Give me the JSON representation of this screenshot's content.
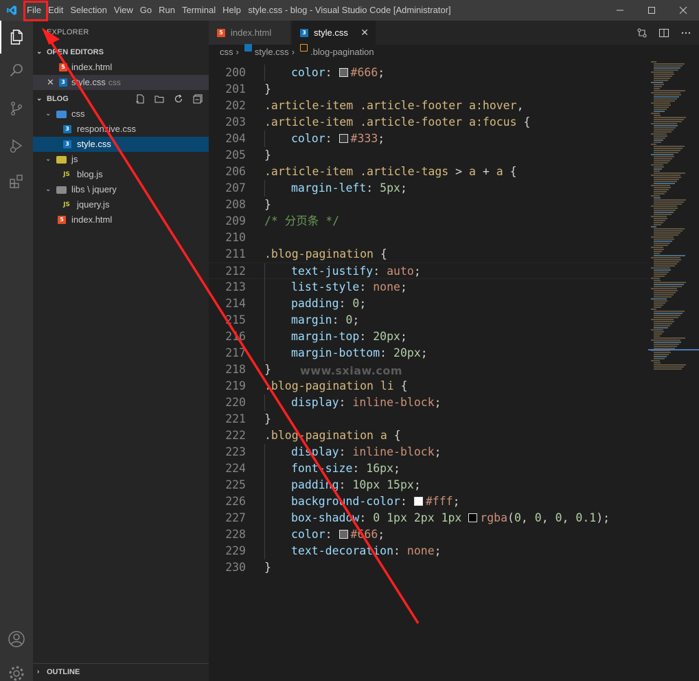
{
  "titlebar": {
    "menu": [
      "File",
      "Edit",
      "Selection",
      "View",
      "Go",
      "Run",
      "Terminal",
      "Help"
    ],
    "window_title": "style.css - blog - Visual Studio Code [Administrator]"
  },
  "activity_bar": [
    "explorer-icon",
    "search-icon",
    "source-control-icon",
    "run-debug-icon",
    "extensions-icon",
    "account-icon",
    "settings-gear-icon"
  ],
  "sidebar": {
    "header": "EXPLORER",
    "open_editors": {
      "title": "OPEN EDITORS",
      "items": [
        {
          "name": "index.html",
          "desc": ""
        },
        {
          "name": "style.css",
          "desc": "css"
        }
      ]
    },
    "folder": {
      "title": "BLOG",
      "tree": [
        {
          "label": "css",
          "type": "folder"
        },
        {
          "label": "responsive.css",
          "type": "css"
        },
        {
          "label": "style.css",
          "type": "css"
        },
        {
          "label": "js",
          "type": "folder"
        },
        {
          "label": "blog.js",
          "type": "js"
        },
        {
          "label": "libs \\ jquery",
          "type": "folder"
        },
        {
          "label": "jquery.js",
          "type": "js"
        },
        {
          "label": "index.html",
          "type": "html"
        }
      ]
    },
    "outline": "OUTLINE"
  },
  "tabs": [
    {
      "label": "index.html",
      "active": false
    },
    {
      "label": "style.css",
      "active": true
    }
  ],
  "breadcrumb": {
    "folder": "css",
    "file": "style.css",
    "symbol": ".blog-pagination"
  },
  "code_lines": [
    {
      "n": "200",
      "indent": 1,
      "tokens": [
        [
          "c-prop",
          "color"
        ],
        [
          "c-pun",
          ": "
        ],
        [
          "swatch",
          "#666666"
        ],
        [
          "c-val",
          "#666"
        ],
        [
          "c-pun",
          ";"
        ]
      ]
    },
    {
      "n": "201",
      "indent": 0,
      "tokens": [
        [
          "c-pun",
          "}"
        ]
      ]
    },
    {
      "n": "202",
      "indent": 0,
      "tokens": [
        [
          "c-sel",
          ".article-item .article-footer a:hover"
        ],
        [
          "c-pun",
          ","
        ]
      ]
    },
    {
      "n": "203",
      "indent": 0,
      "tokens": [
        [
          "c-sel",
          ".article-item .article-footer a:focus"
        ],
        [
          "c-pun",
          " {"
        ]
      ]
    },
    {
      "n": "204",
      "indent": 1,
      "tokens": [
        [
          "c-prop",
          "color"
        ],
        [
          "c-pun",
          ": "
        ],
        [
          "swatch",
          "#333333"
        ],
        [
          "c-val",
          "#333"
        ],
        [
          "c-pun",
          ";"
        ]
      ]
    },
    {
      "n": "205",
      "indent": 0,
      "tokens": [
        [
          "c-pun",
          "}"
        ]
      ]
    },
    {
      "n": "206",
      "indent": 0,
      "tokens": [
        [
          "c-sel",
          ".article-item .article-tags"
        ],
        [
          "c-pun",
          " > "
        ],
        [
          "c-sel",
          "a"
        ],
        [
          "c-pun",
          " + "
        ],
        [
          "c-sel",
          "a"
        ],
        [
          "c-pun",
          " {"
        ]
      ]
    },
    {
      "n": "207",
      "indent": 1,
      "tokens": [
        [
          "c-prop",
          "margin-left"
        ],
        [
          "c-pun",
          ": "
        ],
        [
          "c-num",
          "5px"
        ],
        [
          "c-pun",
          ";"
        ]
      ]
    },
    {
      "n": "208",
      "indent": 0,
      "tokens": [
        [
          "c-pun",
          "}"
        ]
      ]
    },
    {
      "n": "209",
      "indent": 0,
      "tokens": [
        [
          "c-cmt",
          "/* 分页条 */"
        ]
      ]
    },
    {
      "n": "210",
      "indent": 0,
      "tokens": []
    },
    {
      "n": "211",
      "indent": 0,
      "tokens": [
        [
          "c-sel",
          ".blog-pagination"
        ],
        [
          "c-pun",
          " {"
        ]
      ]
    },
    {
      "n": "212",
      "indent": 1,
      "tokens": [
        [
          "c-prop",
          "text-justify"
        ],
        [
          "c-pun",
          ": "
        ],
        [
          "c-val",
          "auto"
        ],
        [
          "c-pun",
          ";"
        ]
      ]
    },
    {
      "n": "213",
      "indent": 1,
      "tokens": [
        [
          "c-prop",
          "list-style"
        ],
        [
          "c-pun",
          ": "
        ],
        [
          "c-val",
          "none"
        ],
        [
          "c-pun",
          ";"
        ]
      ]
    },
    {
      "n": "214",
      "indent": 1,
      "tokens": [
        [
          "c-prop",
          "padding"
        ],
        [
          "c-pun",
          ": "
        ],
        [
          "c-num",
          "0"
        ],
        [
          "c-pun",
          ";"
        ]
      ]
    },
    {
      "n": "215",
      "indent": 1,
      "tokens": [
        [
          "c-prop",
          "margin"
        ],
        [
          "c-pun",
          ": "
        ],
        [
          "c-num",
          "0"
        ],
        [
          "c-pun",
          ";"
        ]
      ]
    },
    {
      "n": "216",
      "indent": 1,
      "tokens": [
        [
          "c-prop",
          "margin-top"
        ],
        [
          "c-pun",
          ": "
        ],
        [
          "c-num",
          "20px"
        ],
        [
          "c-pun",
          ";"
        ]
      ]
    },
    {
      "n": "217",
      "indent": 1,
      "tokens": [
        [
          "c-prop",
          "margin-bottom"
        ],
        [
          "c-pun",
          ": "
        ],
        [
          "c-num",
          "20px"
        ],
        [
          "c-pun",
          ";"
        ]
      ]
    },
    {
      "n": "218",
      "indent": 0,
      "tokens": [
        [
          "c-pun",
          "}"
        ]
      ]
    },
    {
      "n": "219",
      "indent": 0,
      "tokens": [
        [
          "c-sel",
          ".blog-pagination li"
        ],
        [
          "c-pun",
          " {"
        ]
      ]
    },
    {
      "n": "220",
      "indent": 1,
      "tokens": [
        [
          "c-prop",
          "display"
        ],
        [
          "c-pun",
          ": "
        ],
        [
          "c-val",
          "inline-block"
        ],
        [
          "c-pun",
          ";"
        ]
      ]
    },
    {
      "n": "221",
      "indent": 0,
      "tokens": [
        [
          "c-pun",
          "}"
        ]
      ]
    },
    {
      "n": "222",
      "indent": 0,
      "tokens": [
        [
          "c-sel",
          ".blog-pagination a"
        ],
        [
          "c-pun",
          " {"
        ]
      ]
    },
    {
      "n": "223",
      "indent": 1,
      "tokens": [
        [
          "c-prop",
          "display"
        ],
        [
          "c-pun",
          ": "
        ],
        [
          "c-val",
          "inline-block"
        ],
        [
          "c-pun",
          ";"
        ]
      ]
    },
    {
      "n": "224",
      "indent": 1,
      "tokens": [
        [
          "c-prop",
          "font-size"
        ],
        [
          "c-pun",
          ": "
        ],
        [
          "c-num",
          "16px"
        ],
        [
          "c-pun",
          ";"
        ]
      ]
    },
    {
      "n": "225",
      "indent": 1,
      "tokens": [
        [
          "c-prop",
          "padding"
        ],
        [
          "c-pun",
          ": "
        ],
        [
          "c-num",
          "10px 15px"
        ],
        [
          "c-pun",
          ";"
        ]
      ]
    },
    {
      "n": "226",
      "indent": 1,
      "tokens": [
        [
          "c-prop",
          "background-color"
        ],
        [
          "c-pun",
          ": "
        ],
        [
          "swatch",
          "#ffffff"
        ],
        [
          "c-val",
          "#fff"
        ],
        [
          "c-pun",
          ";"
        ]
      ]
    },
    {
      "n": "227",
      "indent": 1,
      "tokens": [
        [
          "c-prop",
          "box-shadow"
        ],
        [
          "c-pun",
          ": "
        ],
        [
          "c-num",
          "0 1px 2px 1px "
        ],
        [
          "swatch",
          "#000000"
        ],
        [
          "c-val",
          "rgba"
        ],
        [
          "c-pun",
          "("
        ],
        [
          "c-num",
          "0"
        ],
        [
          "c-pun",
          ", "
        ],
        [
          "c-num",
          "0"
        ],
        [
          "c-pun",
          ", "
        ],
        [
          "c-num",
          "0"
        ],
        [
          "c-pun",
          ", "
        ],
        [
          "c-num",
          "0.1"
        ],
        [
          "c-pun",
          ");"
        ]
      ]
    },
    {
      "n": "228",
      "indent": 1,
      "tokens": [
        [
          "c-prop",
          "color"
        ],
        [
          "c-pun",
          ": "
        ],
        [
          "swatch",
          "#666666"
        ],
        [
          "c-val",
          "#666"
        ],
        [
          "c-pun",
          ";"
        ]
      ]
    },
    {
      "n": "229",
      "indent": 1,
      "tokens": [
        [
          "c-prop",
          "text-decoration"
        ],
        [
          "c-pun",
          ": "
        ],
        [
          "c-val",
          "none"
        ],
        [
          "c-pun",
          ";"
        ]
      ]
    },
    {
      "n": "230",
      "indent": 0,
      "tokens": [
        [
          "c-pun",
          "}"
        ]
      ]
    }
  ],
  "watermark": "www.sxiaw.com",
  "colors": {
    "titlebar": "#3c3c3c",
    "activity_bar": "#333333",
    "sidebar": "#252526",
    "editor": "#1e1e1e",
    "selection": "#094771",
    "annotation": "#ff2020",
    "vscode_blue": "#23a9f2"
  }
}
